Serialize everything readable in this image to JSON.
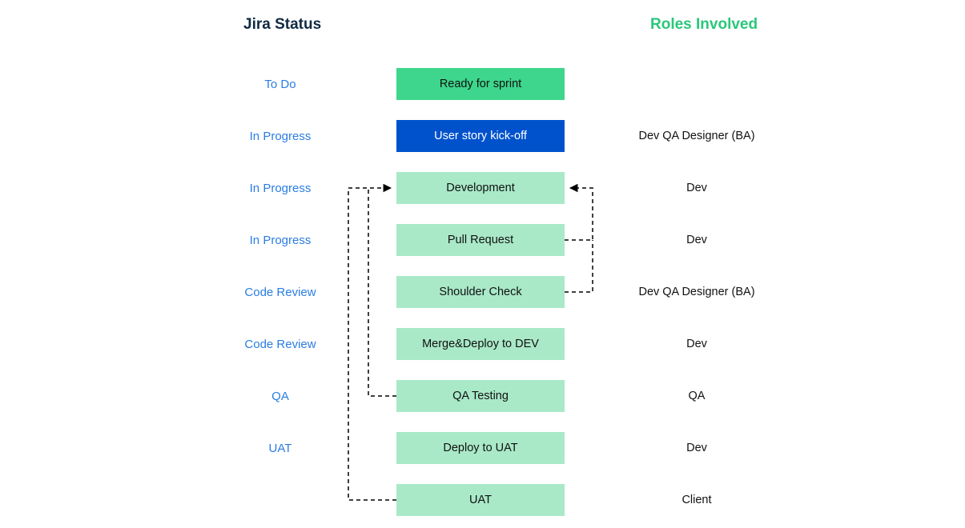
{
  "headers": {
    "status": "Jira Status",
    "roles": "Roles Involved"
  },
  "rows": [
    {
      "status": "To Do",
      "step": "Ready for sprint",
      "role": ""
    },
    {
      "status": "In Progress",
      "step": "User story kick-off",
      "role": "Dev QA Designer (BA)"
    },
    {
      "status": "In Progress",
      "step": "Development",
      "role": "Dev"
    },
    {
      "status": "In Progress",
      "step": "Pull Request",
      "role": "Dev"
    },
    {
      "status": "Code Review",
      "step": "Shoulder Check",
      "role": "Dev QA Designer (BA)"
    },
    {
      "status": "Code Review",
      "step": "Merge&Deploy  to DEV",
      "role": "Dev"
    },
    {
      "status": "QA",
      "step": "QA Testing",
      "role": "QA"
    },
    {
      "status": "UAT",
      "step": "Deploy to UAT",
      "role": "Dev"
    },
    {
      "status": "",
      "step": "UAT",
      "role": "Client"
    }
  ]
}
